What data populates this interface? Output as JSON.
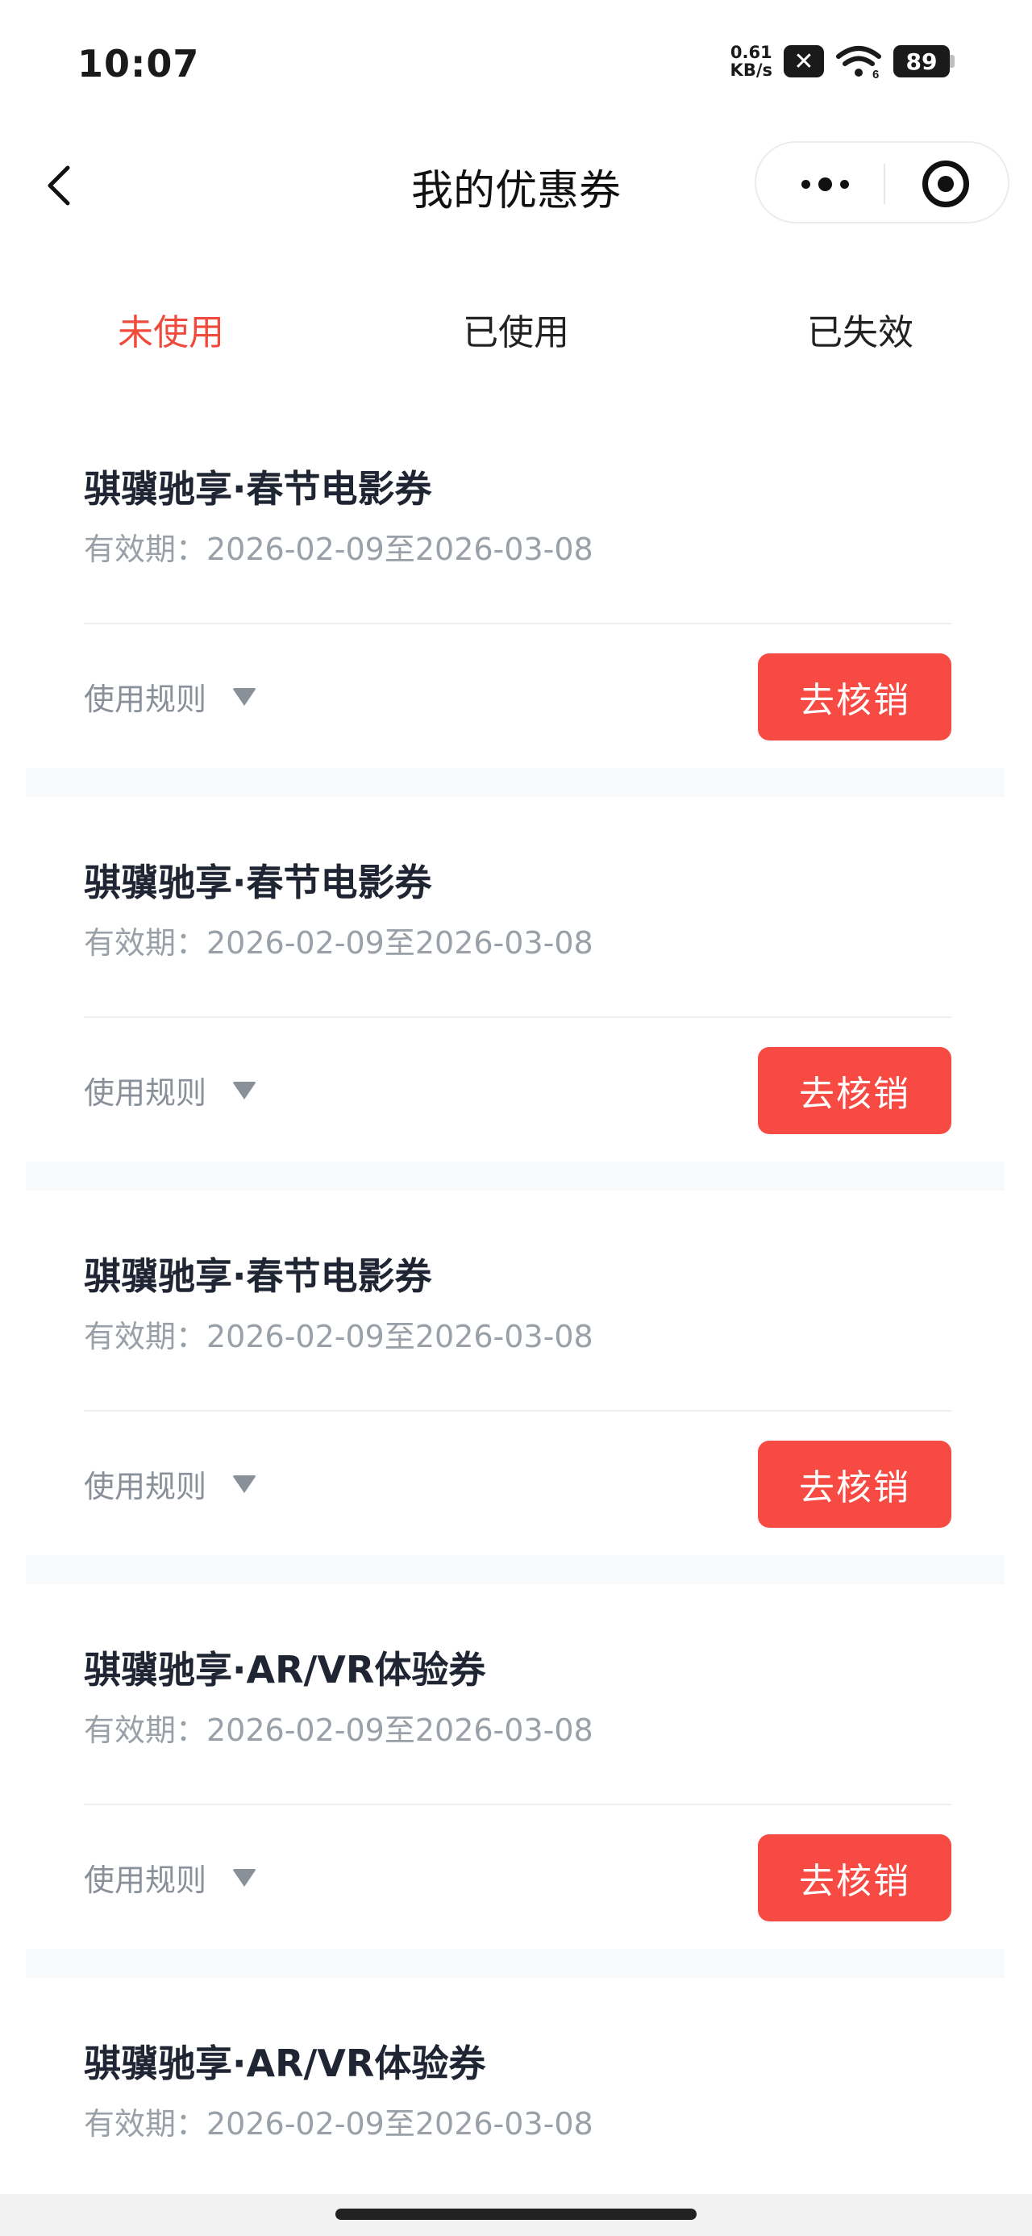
{
  "status_bar": {
    "time": "10:07",
    "net_speed_value": "0.61",
    "net_speed_unit": "KB/s",
    "sim_icon": "x",
    "wifi_badge": "6",
    "battery": "89"
  },
  "nav": {
    "title": "我的优惠券"
  },
  "tabs": [
    {
      "label": "未使用",
      "active": true
    },
    {
      "label": "已使用",
      "active": false
    },
    {
      "label": "已失效",
      "active": false
    }
  ],
  "coupons": [
    {
      "title": "骐骥驰享·春节电影券",
      "validity": "有效期：2026-02-09至2026-03-08",
      "rules_label": "使用规则",
      "action_label": "去核销"
    },
    {
      "title": "骐骥驰享·春节电影券",
      "validity": "有效期：2026-02-09至2026-03-08",
      "rules_label": "使用规则",
      "action_label": "去核销"
    },
    {
      "title": "骐骥驰享·春节电影券",
      "validity": "有效期：2026-02-09至2026-03-08",
      "rules_label": "使用规则",
      "action_label": "去核销"
    },
    {
      "title": "骐骥驰享·AR/VR体验券",
      "validity": "有效期：2026-02-09至2026-03-08",
      "rules_label": "使用规则",
      "action_label": "去核销"
    },
    {
      "title": "骐骥驰享·AR/VR体验券",
      "validity": "有效期：2026-02-09至2026-03-08"
    }
  ],
  "colors": {
    "accent": "#f74a42",
    "active_tab": "#f04a3c",
    "muted_text": "#9aa0a8"
  }
}
